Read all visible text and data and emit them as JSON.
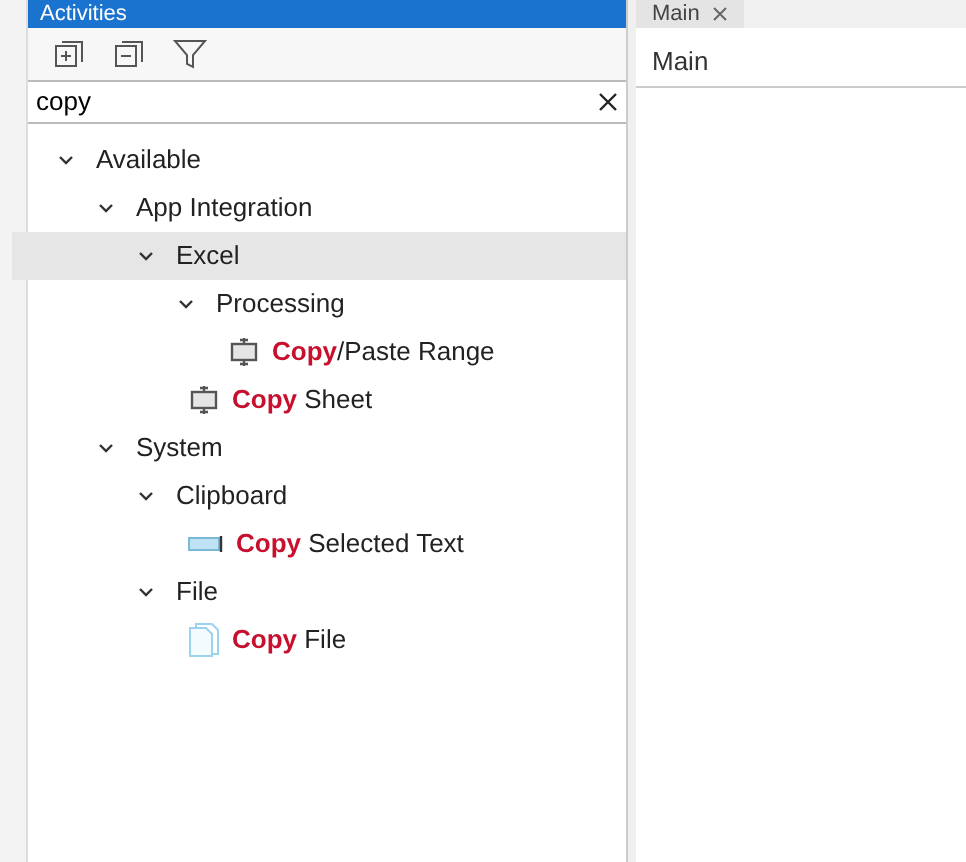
{
  "panel": {
    "title": "Activities"
  },
  "search": {
    "value": "copy"
  },
  "tree": [
    {
      "kind": "category",
      "label": "Available",
      "expanded": true,
      "selected": false,
      "children": [
        {
          "kind": "category",
          "label": "App Integration",
          "expanded": true,
          "selected": false,
          "children": [
            {
              "kind": "category",
              "label": "Excel",
              "expanded": true,
              "selected": true,
              "children": [
                {
                  "kind": "category",
                  "label": "Processing",
                  "expanded": true,
                  "selected": false,
                  "children": [
                    {
                      "kind": "range",
                      "match": "Copy",
                      "rest": "/Paste Range",
                      "selected": false
                    }
                  ]
                },
                {
                  "kind": "range",
                  "match": "Copy",
                  "rest": " Sheet",
                  "selected": false
                }
              ]
            }
          ]
        },
        {
          "kind": "category",
          "label": "System",
          "expanded": true,
          "selected": false,
          "children": [
            {
              "kind": "category",
              "label": "Clipboard",
              "expanded": true,
              "selected": false,
              "children": [
                {
                  "kind": "text",
                  "match": "Copy",
                  "rest": " Selected Text",
                  "selected": false
                }
              ]
            },
            {
              "kind": "category",
              "label": "File",
              "expanded": true,
              "selected": false,
              "children": [
                {
                  "kind": "file",
                  "match": "Copy",
                  "rest": " File",
                  "selected": false
                }
              ]
            }
          ]
        }
      ]
    }
  ],
  "document": {
    "tab": "Main",
    "heading": "Main"
  }
}
